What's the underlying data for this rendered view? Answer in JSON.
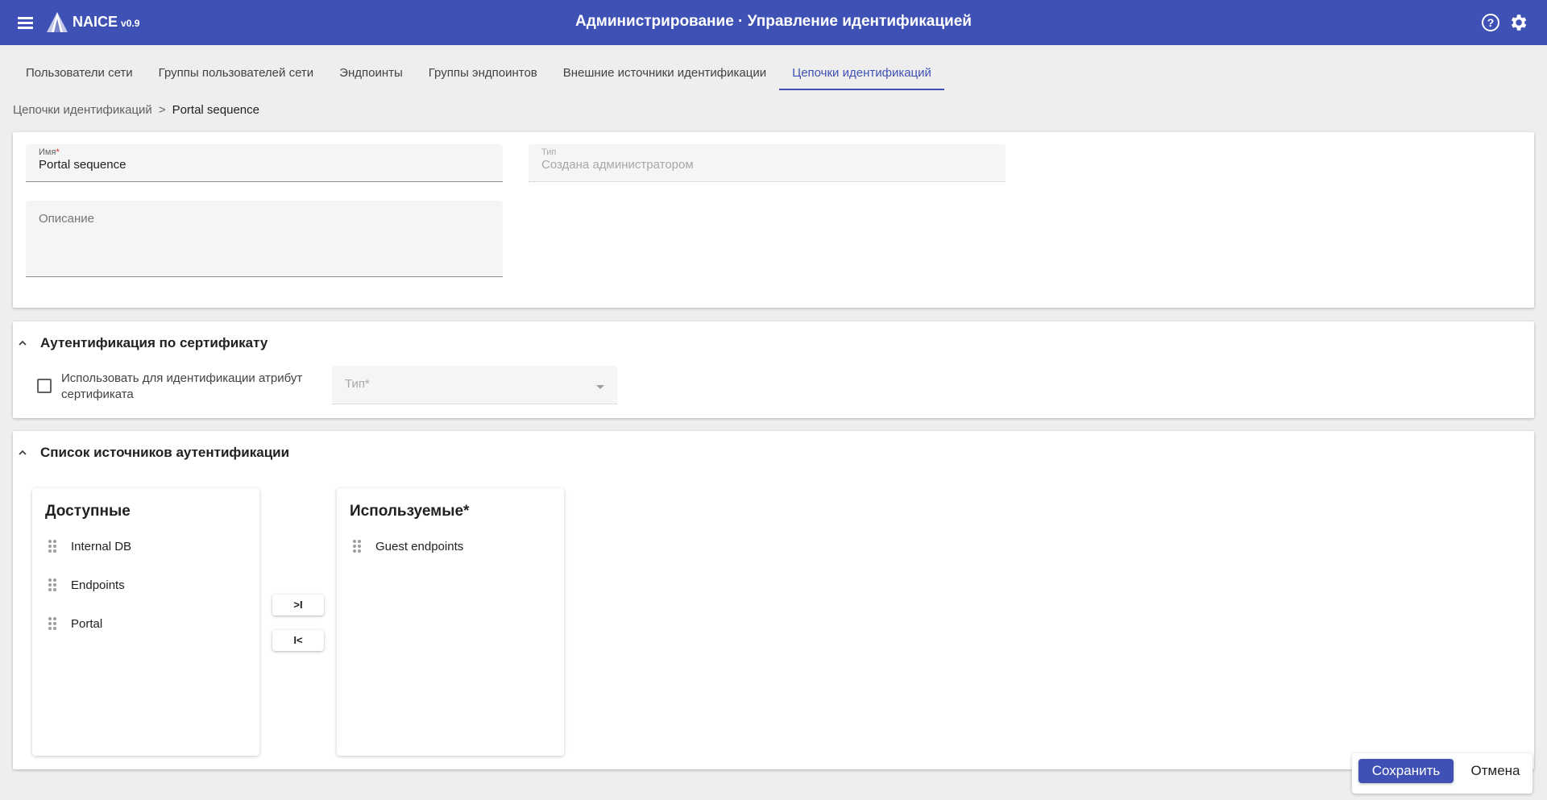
{
  "header": {
    "app_name": "NAICE",
    "version": "v0.9",
    "title": "Администрирование · Управление идентификацией",
    "color": "#3f51b5"
  },
  "tabs": [
    {
      "label": "Пользователи сети",
      "active": false
    },
    {
      "label": "Группы пользователей сети",
      "active": false
    },
    {
      "label": "Эндпоинты",
      "active": false
    },
    {
      "label": "Группы эндпоинтов",
      "active": false
    },
    {
      "label": "Внешние источники идентификации",
      "active": false
    },
    {
      "label": "Цепочки идентификаций",
      "active": true
    }
  ],
  "breadcrumb": {
    "parent": "Цепочки идентификаций",
    "separator": ">",
    "current": "Portal sequence"
  },
  "form": {
    "name": {
      "label": "Имя",
      "required_mark": "*",
      "value": "Portal sequence"
    },
    "type": {
      "label": "Тип",
      "value": "Создана администратором"
    },
    "description": {
      "placeholder": "Описание",
      "value": ""
    }
  },
  "cert_section": {
    "title": "Аутентификация по сертификату",
    "checkbox_label": "Использовать для идентификации атрибут сертификата",
    "checkbox_checked": false,
    "type_select": {
      "placeholder": "Тип*",
      "value": ""
    }
  },
  "sources_section": {
    "title": "Список источников аутентификации",
    "available": {
      "title": "Доступные",
      "items": [
        "Internal DB",
        "Endpoints",
        "Portal"
      ]
    },
    "used": {
      "title": "Используемые*",
      "items": [
        "Guest endpoints"
      ]
    },
    "move_right_label": ">I",
    "move_left_label": "I<"
  },
  "actions": {
    "save": "Сохранить",
    "cancel": "Отмена"
  }
}
